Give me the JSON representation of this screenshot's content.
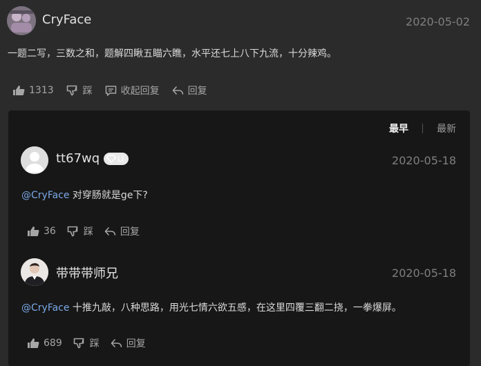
{
  "post": {
    "author": "CryFace",
    "date": "2020-05-02",
    "content": "一题二写，三数之和，题解四瞅五瞄六瞧，水平还七上八下九流，十分辣鸡。",
    "likes": "1313",
    "dislike_label": "踩",
    "collapse_label": "收起回复",
    "reply_label": "回复"
  },
  "sort": {
    "earliest": "最早",
    "latest": "最新"
  },
  "replies": [
    {
      "author": "tt67wq",
      "badge": "LI",
      "date": "2020-05-18",
      "mention": "@CryFace",
      "text": " 对穿肠就是ge下?",
      "likes": "36",
      "dislike_label": "踩",
      "reply_label": "回复"
    },
    {
      "author": "带带带师兄",
      "date": "2020-05-18",
      "mention": "@CryFace",
      "text": " 十推九敲，八种思路，用光七情六欲五感，在这里四覆三翻二挠，一拳爆屏。",
      "likes": "689",
      "dislike_label": "踩",
      "reply_label": "回复"
    }
  ]
}
